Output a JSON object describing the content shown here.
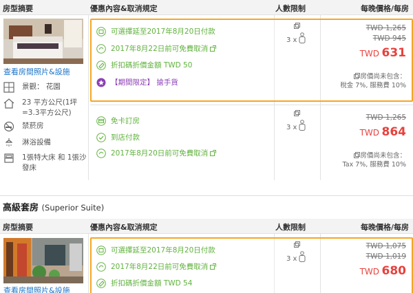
{
  "headers": {
    "type": "房型摘要",
    "offer": "優惠內容&取消規定",
    "limit": "人數限制",
    "price": "每晚價格/每房"
  },
  "room1": {
    "photo_link": "查看房間照片&設施",
    "features": [
      {
        "icon": "view-icon",
        "text": "景觀： 花園"
      },
      {
        "icon": "house-size-icon",
        "text": "23 平方公尺(1坪=3.3平方公尺)"
      },
      {
        "icon": "no-smoking-icon",
        "text": "禁菸房"
      },
      {
        "icon": "shower-icon",
        "text": "淋浴設備"
      },
      {
        "icon": "bed-icon",
        "text": "1張特大床 和 1張沙發床"
      }
    ],
    "rates": [
      {
        "lines": [
          {
            "icon": "calendar-icon",
            "text": "可選擇延至2017年8月20日付款",
            "style": "green"
          },
          {
            "icon": "refund-icon",
            "text": "2017年8月22日前可免費取消",
            "style": "green",
            "ext": true
          },
          {
            "icon": "discount-icon",
            "text": "折扣碼折價金額 TWD 50",
            "style": "green"
          },
          {
            "icon": "star-badge-icon",
            "text": "【期間限定】 搶手貨",
            "style": "purple"
          }
        ],
        "occupancy": "3 x",
        "old_prices": [
          "TWD 1,265",
          "TWD 945"
        ],
        "currency": "TWD",
        "price": "631",
        "tax_lines": [
          "房價尚未包含：",
          "稅金 7%, 服務費 10%"
        ]
      },
      {
        "lines": [
          {
            "icon": "card-icon",
            "text": "免卡訂房",
            "style": "green"
          },
          {
            "icon": "check-icon",
            "text": "到店付款",
            "style": "green"
          },
          {
            "icon": "refund-icon",
            "text": "2017年8月20日前可免費取消",
            "style": "green",
            "ext": true
          }
        ],
        "occupancy": "3 x",
        "old_prices": [
          "TWD 1,265"
        ],
        "currency": "TWD",
        "price": "864",
        "tax_lines": [
          "房價尚未包含：",
          "Tax 7%, 服務費 10%"
        ]
      }
    ]
  },
  "room2": {
    "title": "高級套房",
    "title_en": "(Superior Suite)",
    "photo_link": "查看房間照片&設施",
    "rate": {
      "lines": [
        {
          "icon": "calendar-icon",
          "text": "可選擇延至2017年8月20日付款",
          "style": "green"
        },
        {
          "icon": "refund-icon",
          "text": "2017年8月22日前可免費取消",
          "style": "green",
          "ext": true
        },
        {
          "icon": "discount-icon",
          "text": "折扣碼折價金額 TWD 54",
          "style": "green"
        }
      ],
      "occupancy": "3 x",
      "old_prices": [
        "TWD 1,075",
        "TWD 1,019"
      ],
      "currency": "TWD",
      "price": "680"
    }
  },
  "colors": {
    "green": "#5fb13c",
    "purple": "#8d3fb6",
    "highlight": "#f5a623",
    "price": "#e8413c",
    "link": "#1a73c8"
  }
}
